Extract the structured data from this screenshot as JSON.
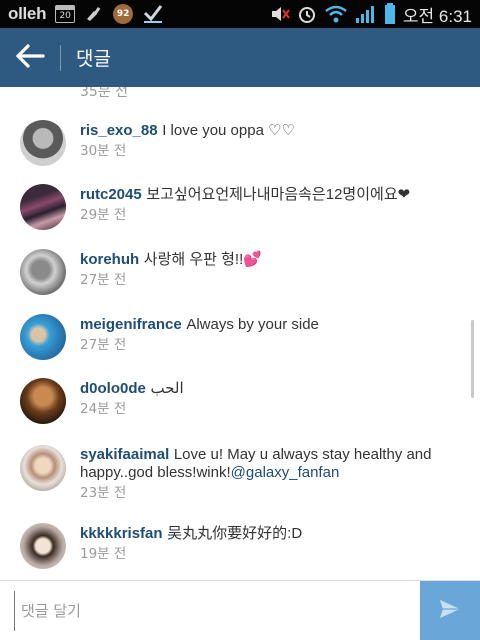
{
  "status_bar": {
    "carrier": "olleh",
    "calendar_day": "20",
    "badge": "92",
    "time": "오전 6:31",
    "icons": [
      "calendar-icon",
      "cleaner-icon",
      "badge-92-icon",
      "check-icon",
      "mute-icon",
      "alarm-icon",
      "wifi-icon",
      "signal-icon",
      "battery-icon"
    ]
  },
  "header": {
    "title": "댓글",
    "back_icon": "arrow-left-icon",
    "background": "#2e5a82"
  },
  "comments": {
    "partial_time": "35분 전",
    "items": [
      {
        "username": "ris_exo_88",
        "text": "I love you oppa ♡♡",
        "time": "30분 전"
      },
      {
        "username": "rutc2045",
        "text": "보고싶어요언제나내마음속은12명이에요❤",
        "time": "29분 전"
      },
      {
        "username": "korehuh",
        "text": "사랑해 우판 형!!💕",
        "time": "27분 전"
      },
      {
        "username": "meigenifrance",
        "text": "Always by your side",
        "time": "27분 전"
      },
      {
        "username": "d0olo0de",
        "text": "الحب",
        "time": "24분 전"
      },
      {
        "username": "syakifaaimal",
        "text": "Love u! May u always stay healthy and happy..god bless!wink!",
        "mention": "@galaxy_fanfan",
        "time": "23분 전"
      },
      {
        "username": "kkkkkrisfan",
        "text": "吴丸丸你要好好的:D",
        "time": "19분 전"
      }
    ]
  },
  "input": {
    "placeholder": "댓글 달기",
    "value": ""
  },
  "colors": {
    "accent": "#2e5a82",
    "username": "#1f4d73",
    "send_button": "#6aa6d8"
  }
}
